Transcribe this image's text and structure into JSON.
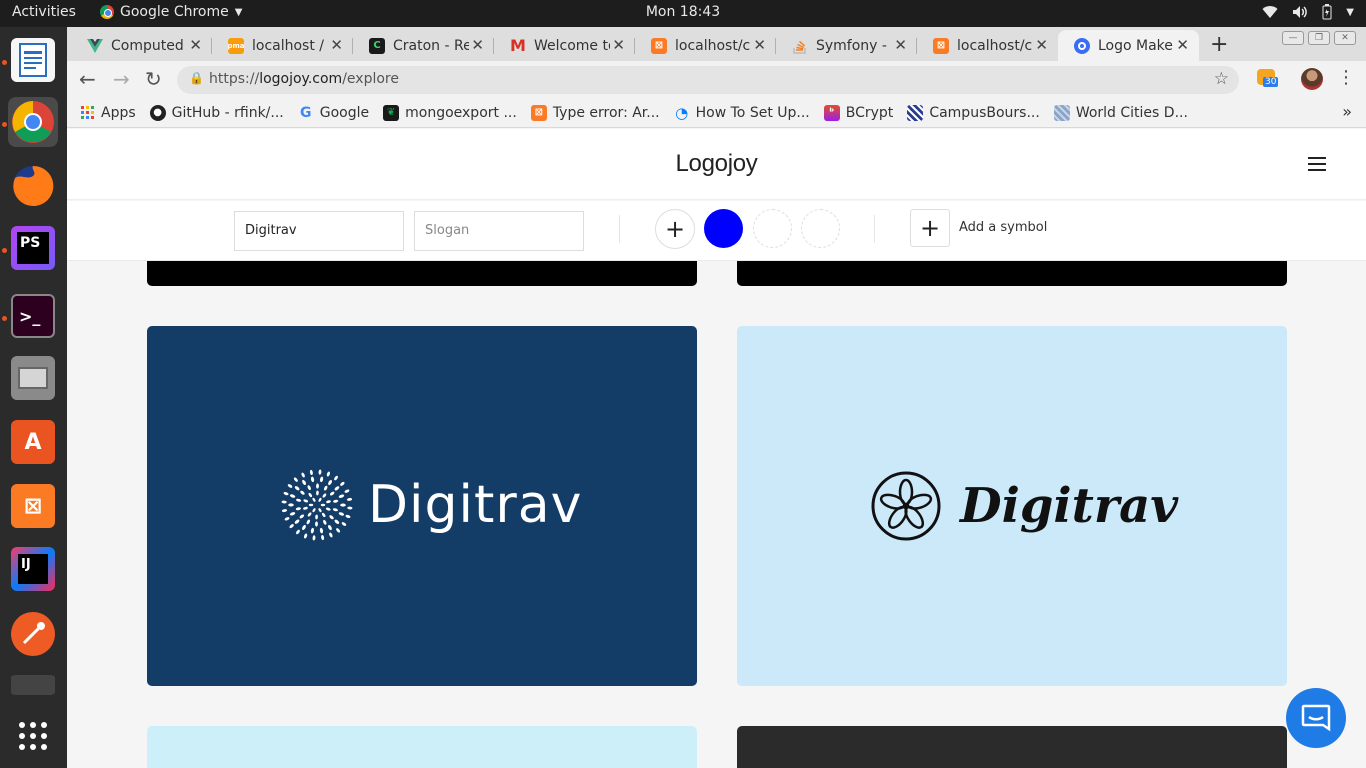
{
  "topbar": {
    "activities": "Activities",
    "app_name": "Google Chrome",
    "clock": "Mon 18:43"
  },
  "dock": {
    "items": [
      "libreoffice-writer-icon",
      "chrome-icon",
      "firefox-icon",
      "phpstorm-icon",
      "terminal-icon",
      "files-icon",
      "software-center-icon",
      "xampp-icon",
      "intellij-icon",
      "postman-icon",
      "show-apps-icon"
    ]
  },
  "tabs": [
    {
      "label": "Computed",
      "icon": "vue-icon",
      "color": "#41b883"
    },
    {
      "label": "localhost /",
      "icon": "phpmyadmin-icon",
      "color": "#f89c0e"
    },
    {
      "label": "Craton - Re",
      "icon": "craton-icon",
      "color": "#1a1a1a"
    },
    {
      "label": "Welcome to",
      "icon": "gmail-icon",
      "color": "#d93025"
    },
    {
      "label": "localhost/c",
      "icon": "xampp-icon",
      "color": "#fb7a24"
    },
    {
      "label": "Symfony - c",
      "icon": "stackoverflow-icon",
      "color": "#f48024"
    },
    {
      "label": "localhost/c",
      "icon": "xampp-icon",
      "color": "#fb7a24"
    },
    {
      "label": "Logo Make",
      "icon": "logojoy-icon",
      "color": "#3a6cf5"
    }
  ],
  "toolbar": {
    "url_prefix": "https://",
    "url_domain": "logojoy.com",
    "url_path": "/explore",
    "ext_badge": "30"
  },
  "bookmarks": [
    {
      "label": "Apps",
      "icon": "apps-grid-icon",
      "color": "#e94235"
    },
    {
      "label": "GitHub - rfink/...",
      "icon": "github-icon",
      "color": "#222222"
    },
    {
      "label": "Google",
      "icon": "google-icon",
      "color": "#4285f4"
    },
    {
      "label": "mongoexport ...",
      "icon": "mongodb-icon",
      "color": "#13aa52"
    },
    {
      "label": "Type error: Ar...",
      "icon": "xampp-icon",
      "color": "#fb7a24"
    },
    {
      "label": "How To Set Up...",
      "icon": "digitalocean-icon",
      "color": "#0080ff"
    },
    {
      "label": "BCrypt",
      "icon": "bcrypt-icon",
      "color": "#e44d26"
    },
    {
      "label": "CampusBours...",
      "icon": "campus-icon",
      "color": "#2a3d8f"
    },
    {
      "label": "World Cities D...",
      "icon": "world-cities-icon",
      "color": "#8aa4c8"
    }
  ],
  "site": {
    "brand": "Logojoy",
    "name_value": "Digitrav",
    "slogan_placeholder": "Slogan",
    "add_symbol": "Add a symbol",
    "selected_color": "#0000ff"
  },
  "cards": [
    {
      "bg": "#000000"
    },
    {
      "bg": "#000000"
    },
    {
      "bg": "#133c66",
      "logo_text": "Digitrav",
      "symbol": "dots-burst-icon"
    },
    {
      "bg": "#cbe9f9",
      "logo_text": "Digitrav",
      "symbol": "flower-circle-icon"
    },
    {
      "bg": "#cdeffa"
    },
    {
      "bg": "#2b2b2b"
    }
  ]
}
